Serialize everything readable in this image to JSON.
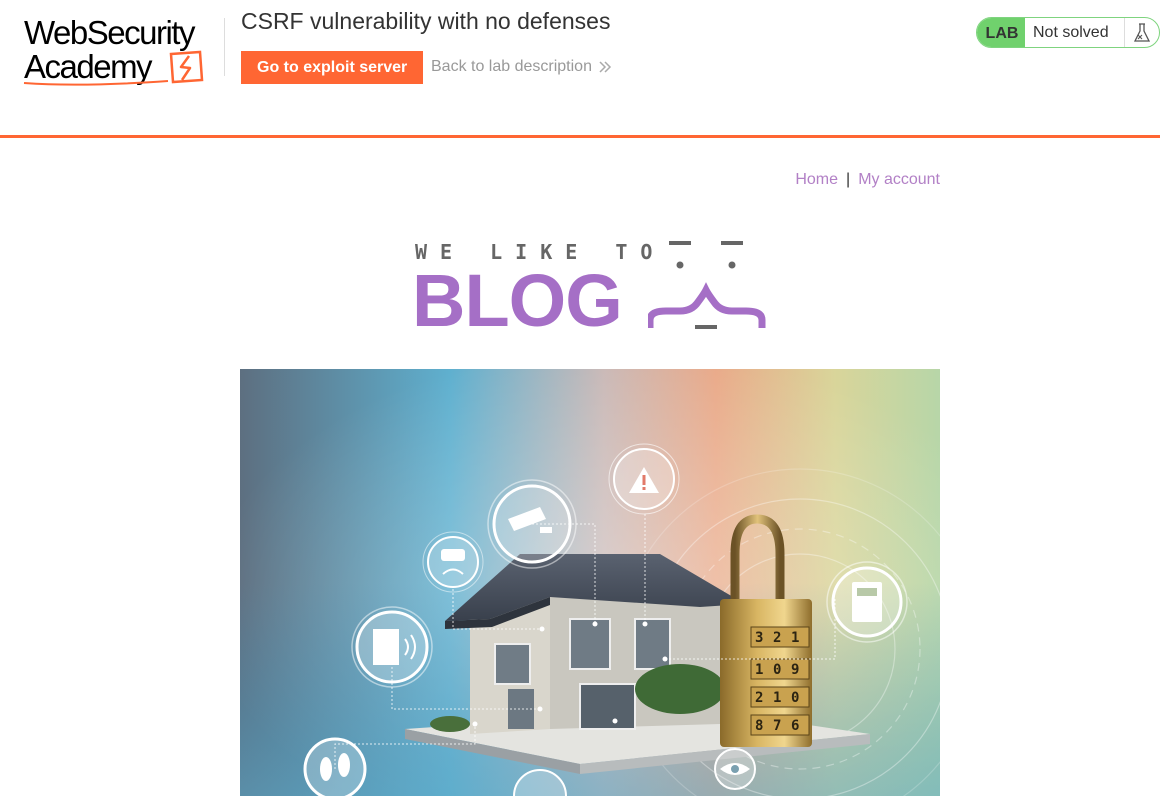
{
  "lab": {
    "title": "CSRF vulnerability with no defenses",
    "exploit_button": "Go to exploit server",
    "back_link": "Back to lab description",
    "status_badge": "LAB",
    "status_text": "Not solved"
  },
  "logo": {
    "line1": "WebSecurity",
    "line2": "Academy"
  },
  "nav": {
    "home": "Home",
    "separator": "|",
    "my_account": "My account"
  },
  "blog_banner": {
    "small_text": "WE LIKE TO",
    "big_text": "BLOG"
  },
  "hero_lock_digits": [
    "3",
    "2",
    "1",
    "1",
    "0",
    "9",
    "2",
    "1",
    "0",
    "8",
    "7",
    "6"
  ],
  "colors": {
    "accent_orange": "#ff6633",
    "blog_purple": "#a56fc6",
    "link_purple": "#b280c6",
    "status_green": "#70d16d"
  }
}
